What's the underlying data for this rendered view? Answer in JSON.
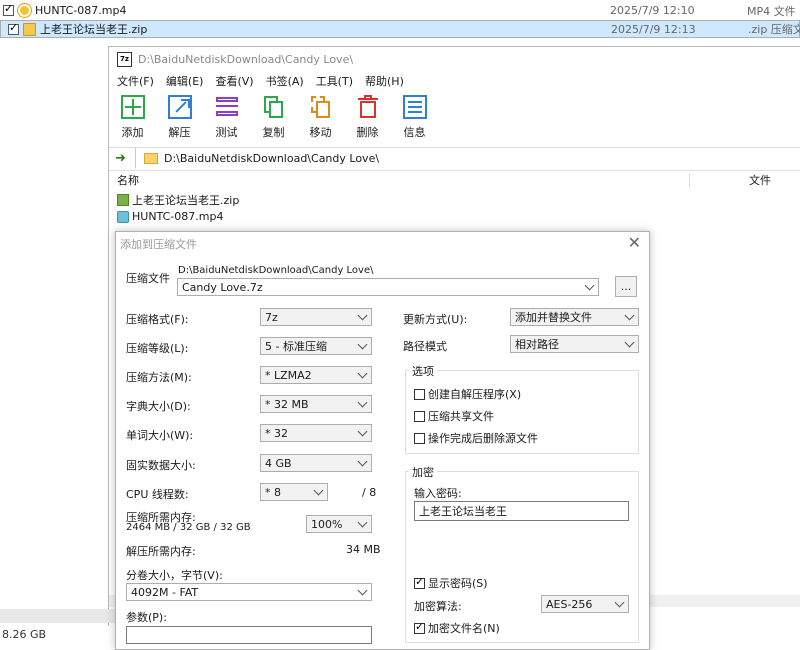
{
  "explorer": {
    "files": [
      {
        "name": "HUNTC-087.mp4",
        "date": "2025/7/9 12:10",
        "type": "MP4 文件"
      },
      {
        "name": "上老王论坛当老王.zip",
        "date": "2025/7/9 12:13",
        "type": ".zip 压缩文件"
      }
    ],
    "total_size": "8.26 GB"
  },
  "file_manager": {
    "title": "D:\\BaiduNetdiskDownload\\Candy Love\\",
    "logo_text": "7z",
    "menu": [
      "文件(F)",
      "编辑(E)",
      "查看(V)",
      "书签(A)",
      "工具(T)",
      "帮助(H)"
    ],
    "toolbar": [
      "添加",
      "解压",
      "测试",
      "复制",
      "移动",
      "删除",
      "信息"
    ],
    "address": "D:\\BaiduNetdiskDownload\\Candy Love\\",
    "columns": {
      "name": "名称",
      "type": "文件"
    },
    "files": [
      "上老王论坛当老王.zip",
      "HUNTC-087.mp4"
    ]
  },
  "dialog": {
    "title": "添加到压缩文件",
    "archive_label": "压缩文件",
    "archive_path": "D:\\BaiduNetdiskDownload\\Candy Love\\",
    "archive_name": "Candy Love.7z",
    "browse_label": "...",
    "format_label": "压缩格式(F):",
    "format_value": "7z",
    "level_label": "压缩等级(L):",
    "level_value": "5 - 标准压缩",
    "method_label": "压缩方法(M):",
    "method_value": "* LZMA2",
    "dict_label": "字典大小(D):",
    "dict_value": "* 32 MB",
    "word_label": "单词大小(W):",
    "word_value": "* 32",
    "solid_label": "固实数据大小:",
    "solid_value": "4 GB",
    "cpu_label": "CPU 线程数:",
    "cpu_value": "* 8",
    "cpu_max": "/ 8",
    "mem_comp_label": "压缩所需内存:",
    "mem_comp_value": "2464 MB / 32 GB / 32 GB",
    "mem_percent": "100%",
    "mem_decomp_label": "解压所需内存:",
    "mem_decomp_value": "34 MB",
    "volume_label": "分卷大小，字节(V):",
    "volume_value": "4092M - FAT",
    "params_label": "参数(P):",
    "params_value": "",
    "update_label": "更新方式(U):",
    "update_value": "添加并替换文件",
    "path_label": "路径模式",
    "path_value": "相对路径",
    "options_label": "选项",
    "opt_sfx": "创建自解压程序(X)",
    "opt_shared": "压缩共享文件",
    "opt_delete": "操作完成后删除源文件",
    "encrypt_label": "加密",
    "password_label": "输入密码:",
    "password_value": "上老王论坛当老王",
    "show_password": "显示密码(S)",
    "enc_method_label": "加密算法:",
    "enc_method_value": "AES-256",
    "enc_names": "加密文件名(N)"
  }
}
